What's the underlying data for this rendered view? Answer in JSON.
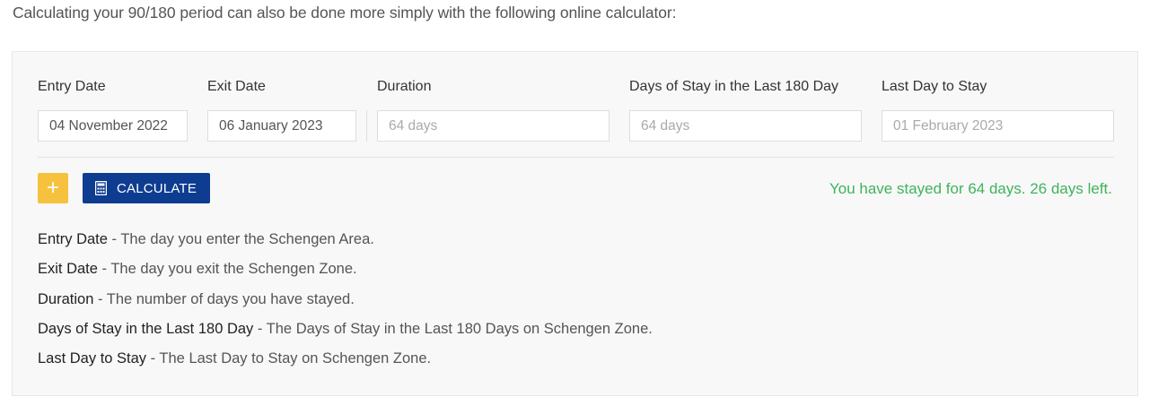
{
  "intro_text": "Calculating your 90/180 period can also be done more simply with the following online calculator:",
  "fields": {
    "entry_date": {
      "label": "Entry Date",
      "value": "04 November 2022"
    },
    "exit_date": {
      "label": "Exit Date",
      "value": "06 January 2023"
    },
    "duration": {
      "label": "Duration",
      "value": "64 days"
    },
    "days_of_stay": {
      "label": "Days of Stay in the Last 180 Day",
      "value": "64 days"
    },
    "last_day": {
      "label": "Last Day to Stay",
      "value": "01 February 2023"
    }
  },
  "buttons": {
    "add_label": "+",
    "calculate_label": "CALCULATE"
  },
  "result_text": "You have stayed for 64 days. 26 days left.",
  "definitions": [
    {
      "term": "Entry Date",
      "text": " - The day you enter the Schengen Area."
    },
    {
      "term": "Exit Date",
      "text": " - The day you exit the Schengen Zone."
    },
    {
      "term": "Duration",
      "text": " - The number of days you have stayed."
    },
    {
      "term": "Days of Stay in the Last 180 Day",
      "text": " - The Days of Stay in the Last 180 Days on Schengen Zone."
    },
    {
      "term": "Last Day to Stay",
      "text": " - The Last Day to Stay on Schengen Zone."
    }
  ],
  "colors": {
    "add_button": "#f6c23e",
    "calculate_button": "#0d3c91",
    "result_text": "#3fb35c"
  },
  "icons": {
    "calculate": "calculator-icon"
  }
}
